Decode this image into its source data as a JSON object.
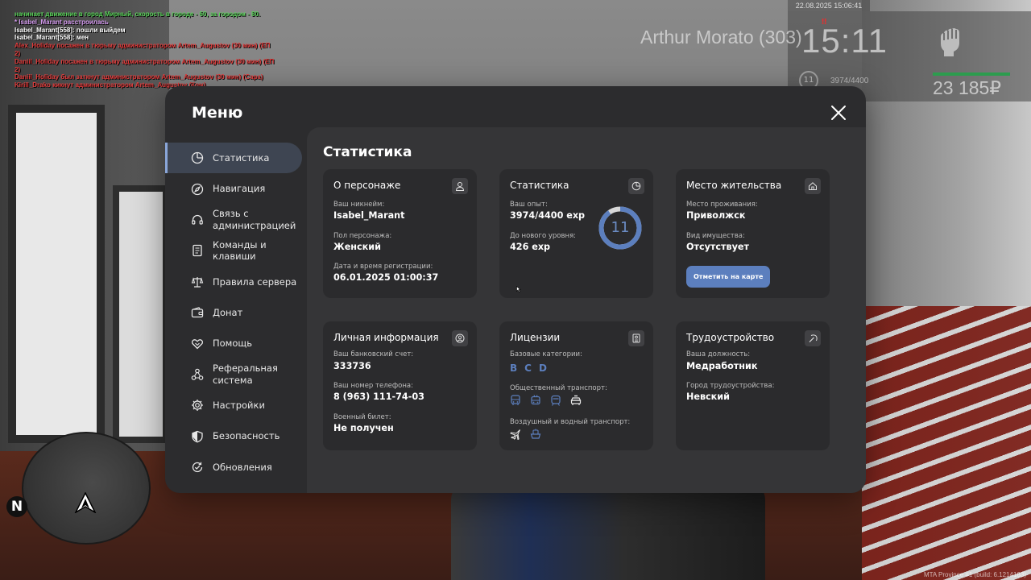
{
  "chat": [
    {
      "text": "начинает движение в город Мирный, скорость в городе - 60, за городом - 80.",
      "color": "#5bd35b"
    },
    {
      "text": "* Isabel_Marant расстроилась",
      "color": "#d59bf0"
    },
    {
      "text": "Isabel_Marant[558]: пошли выйдем",
      "color": "#ffffff",
      "prefix_color": "#d84a4a"
    },
    {
      "text": "Isabel_Marant[558]: мен",
      "color": "#ffffff",
      "prefix_color": "#d84a4a"
    },
    {
      "text": "Alex_Holiday посажен в тюрьму администратором Artem_Augustov (30 мин) (ЕП",
      "color": "#e23b3b"
    },
    {
      "text": "2)",
      "color": "#e23b3b"
    },
    {
      "text": "Daniil_Holiday посажен в тюрьму администратором Artem_Augustov (30 мин) (ЕП",
      "color": "#e23b3b"
    },
    {
      "text": "2)",
      "color": "#e23b3b"
    },
    {
      "text": "Daniil_Holiday был заткнут администратором Artem_Augustov (30 мин) (Сара)",
      "color": "#e23b3b"
    },
    {
      "text": "Kirill_Drako кикнут администратором Artem_Augustov (Ком)",
      "color": "#e23b3b"
    }
  ],
  "hud": {
    "datetime": "22.08.2025 15:06:41",
    "player_name": "Arthur Morato (303)",
    "time": "15:11",
    "money": "23 185₽",
    "level": "11",
    "exp": "3974/4400",
    "health_fraction": 1.0,
    "health_color": "#2c9c4e"
  },
  "minimap": {
    "north": "N"
  },
  "build": "MTA Province #1 (build: 6.1214163)",
  "menu": {
    "title": "Меню",
    "nav": [
      {
        "label": "Статистика",
        "icon": "chart-pie-icon",
        "active": true
      },
      {
        "label": "Навигация",
        "icon": "compass-icon"
      },
      {
        "label": "Связь с администрацией",
        "icon": "headset-icon"
      },
      {
        "label": "Команды и клавиши",
        "icon": "document-icon"
      },
      {
        "label": "Правила сервера",
        "icon": "scales-icon"
      },
      {
        "label": "Донат",
        "icon": "wallet-icon"
      },
      {
        "label": "Помощь",
        "icon": "handshake-icon"
      },
      {
        "label": "Реферальная система",
        "icon": "network-icon"
      },
      {
        "label": "Настройки",
        "icon": "gear-icon"
      },
      {
        "label": "Безопасность",
        "icon": "shield-icon"
      },
      {
        "label": "Обновления",
        "icon": "refresh-check-icon"
      }
    ],
    "content_title": "Статистика",
    "accent": "#5c7fbe",
    "cards": {
      "character": {
        "title": "О персонаже",
        "nickname_label": "Ваш никнейм:",
        "nickname": "Isabel_Marant",
        "gender_label": "Пол персонажа:",
        "gender": "Женский",
        "reg_label": "Дата и время регистрации:",
        "reg": "06.01.2025 01:00:37"
      },
      "stats": {
        "title": "Статистика",
        "exp_label": "Ваш опыт:",
        "exp": "3974/4400 exp",
        "next_label": "До нового уровня:",
        "next": "426 exp",
        "level": "11",
        "level_progress": 0.903
      },
      "residence": {
        "title": "Место жительства",
        "place_label": "Место проживания:",
        "place": "Приволжск",
        "property_label": "Вид имущества:",
        "property": "Отсутствует",
        "map_button": "Отметить на карте"
      },
      "personal": {
        "title": "Личная информация",
        "bank_label": "Ваш банковский счет:",
        "bank": "333736",
        "phone_label": "Ваш номер телефона:",
        "phone": "8 (963) 111-74-03",
        "military_label": "Военный билет:",
        "military": "Не получен"
      },
      "licenses": {
        "title": "Лицензии",
        "base_label": "Базовые категории:",
        "base": [
          "B",
          "C",
          "D"
        ],
        "public_label": "Общественный транспорт:",
        "public_icons": [
          "bus-icon",
          "trolleybus-icon",
          "tram-icon",
          "taxi-icon"
        ],
        "air_label": "Воздушный и водный транспорт:",
        "air_icons": [
          "plane-icon",
          "boat-icon"
        ]
      },
      "employment": {
        "title": "Трудоустройство",
        "position_label": "Ваша должность:",
        "position": "Медработник",
        "city_label": "Город трудоустройства:",
        "city": "Невский"
      }
    }
  }
}
